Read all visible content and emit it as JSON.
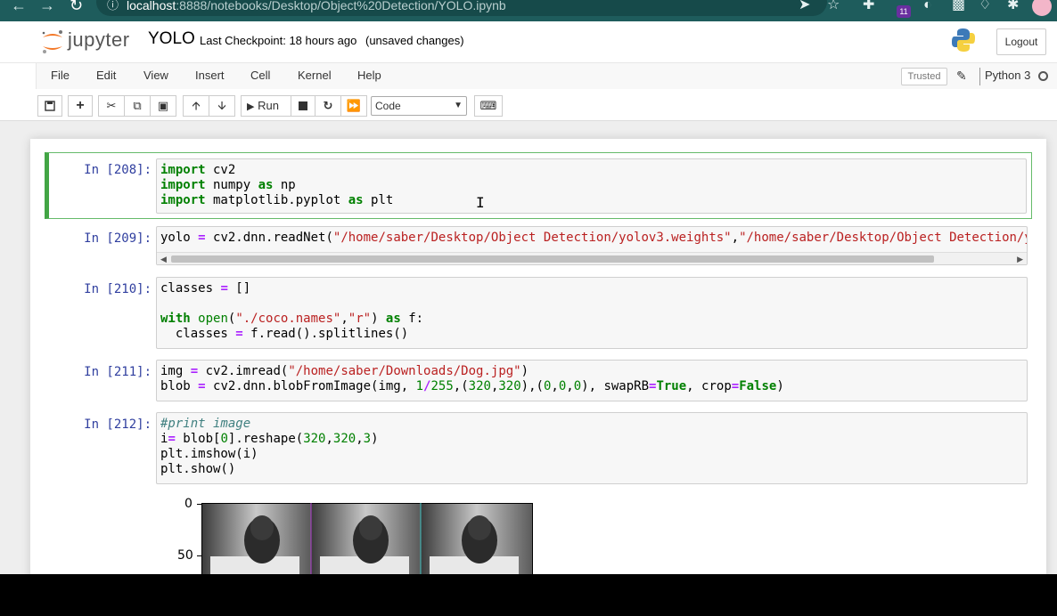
{
  "browser": {
    "url_host": "localhost",
    "url_path": ":8888/notebooks/Desktop/Object%20Detection/YOLO.ipynb",
    "extension_badge": "11"
  },
  "header": {
    "brand": "jupyter",
    "notebook_name": "YOLO",
    "checkpoint": "Last Checkpoint: 18 hours ago",
    "unsaved": "(unsaved changes)",
    "logout_label": "Logout"
  },
  "menubar": {
    "items": [
      "File",
      "Edit",
      "View",
      "Insert",
      "Cell",
      "Kernel",
      "Help"
    ],
    "trusted_label": "Trusted",
    "kernel_name": "Python 3"
  },
  "toolbar": {
    "run_label": "Run",
    "cell_type": "Code"
  },
  "cells": [
    {
      "prompt": "In [208]:"
    },
    {
      "prompt": "In [209]:"
    },
    {
      "prompt": "In [210]:"
    },
    {
      "prompt": "In [211]:"
    },
    {
      "prompt": "In [212]:"
    }
  ],
  "plot": {
    "yticks": [
      "0",
      "50"
    ]
  },
  "colors": {
    "chrome": "#1e5c5c",
    "selected_cell_border": "#42a545",
    "prompt": "#303f9f",
    "keyword": "#008000",
    "operator": "#aa22ff",
    "string": "#ba2121"
  }
}
